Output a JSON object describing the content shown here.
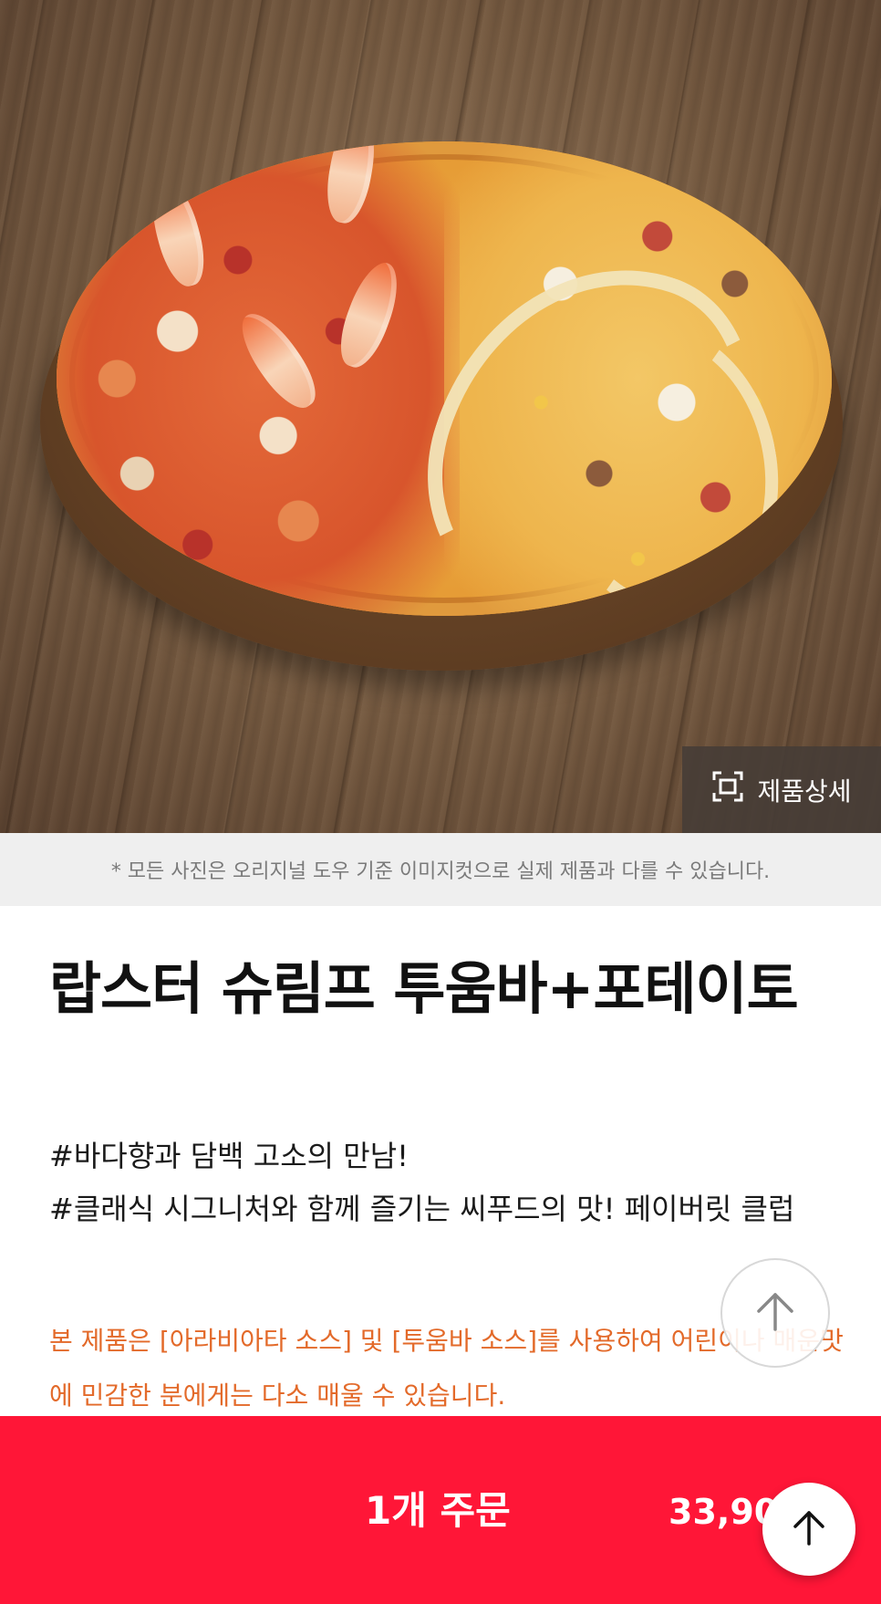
{
  "hero": {
    "detail_label": "제품상세",
    "detail_icon": "expand-frame-icon"
  },
  "disclaimer": {
    "text": "* 모든 사진은 오리지널 도우 기준 이미지컷으로 실제 제품과 다를 수 있습니다."
  },
  "product": {
    "title": "랍스터 슈림프 투움바+포테이토",
    "tags": [
      "#바다향과 담백 고소의 만남!",
      "#클래식 시그니처와 함께 즐기는 씨푸드의 맛! 페이버릿 클럽"
    ],
    "notice": "본 제품은 [아라비아타 소스] 및 [투움바 소스]를 사용하여 어린이나 매운맛에 민감한 분에게는 다소 매울 수 있습니다."
  },
  "order": {
    "label": "1개 주문",
    "price": "33,900원"
  },
  "floating": {
    "scroll_top_icon": "arrow-up-icon"
  },
  "colors": {
    "order_bar": "#ff1637",
    "notice_text": "#e36a2a",
    "disclaimer_bg": "#efefef"
  }
}
